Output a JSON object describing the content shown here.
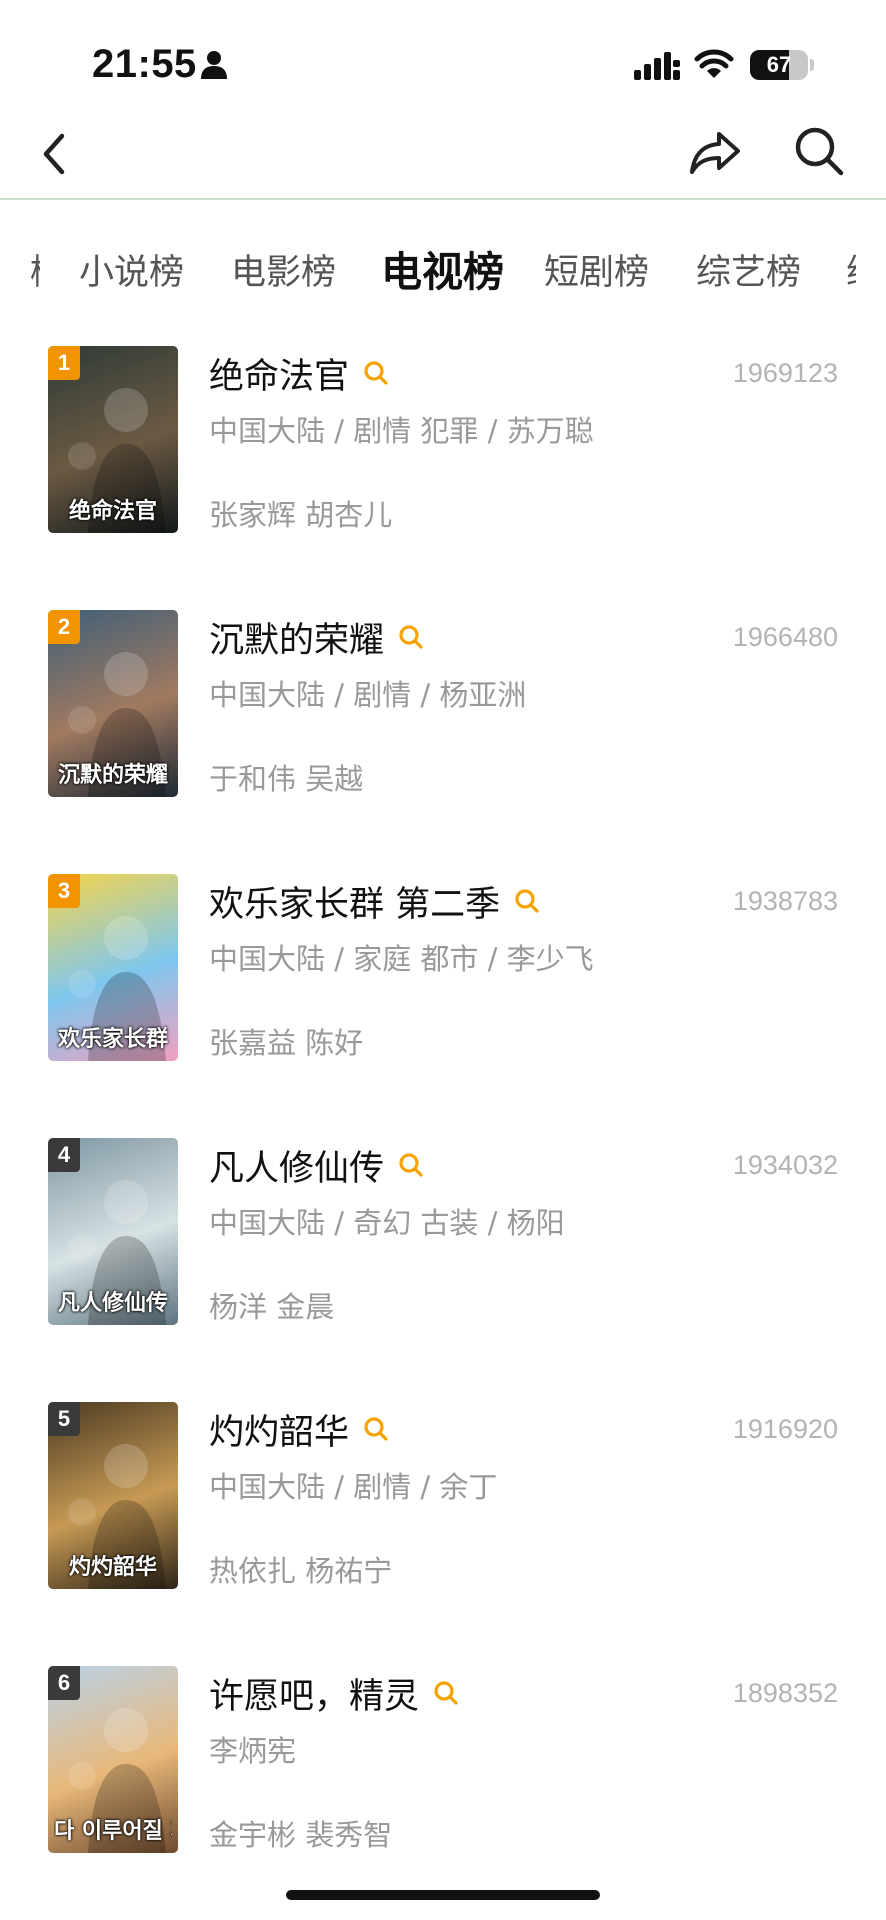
{
  "status_bar": {
    "time": "21:55",
    "battery": "67",
    "battery_level": 0.67,
    "icons": [
      "person-icon",
      "cellular-signal-icon",
      "wifi-icon",
      "battery-icon"
    ]
  },
  "nav": {
    "icons": [
      "back-chevron-icon",
      "share-icon",
      "search-icon"
    ]
  },
  "tabs": {
    "items": [
      "小说榜",
      "电影榜",
      "电视榜",
      "短剧榜",
      "综艺榜"
    ],
    "selected": "电视榜"
  },
  "colors": {
    "rank_top": "#f29300",
    "rank_other": "#3a3a3a",
    "search_accent": "#f5a300",
    "divider": "#c9dcc9"
  },
  "list": [
    {
      "rank": "1",
      "title": "绝命法官",
      "score": "1969123",
      "meta": "中国大陆 / 剧情 犯罪 / 苏万聪",
      "cast": "张家辉 胡杏儿",
      "poster_text": "绝命法官",
      "poster_colors": [
        "#2f3b36",
        "#6b5a43",
        "#12181a"
      ]
    },
    {
      "rank": "2",
      "title": "沉默的荣耀",
      "score": "1966480",
      "meta": "中国大陆 / 剧情 / 杨亚洲",
      "cast": "于和伟 吴越",
      "poster_text": "沉默的荣耀",
      "poster_colors": [
        "#3f5f78",
        "#a07a60",
        "#1e2a36"
      ]
    },
    {
      "rank": "3",
      "title": "欢乐家长群 第二季",
      "score": "1938783",
      "meta": "中国大陆 / 家庭 都市 / 李少飞",
      "cast": "张嘉益 陈好",
      "poster_text": "欢乐家长群",
      "poster_colors": [
        "#f7d44a",
        "#7fc7ee",
        "#f2a0c0"
      ]
    },
    {
      "rank": "4",
      "title": "凡人修仙传",
      "score": "1934032",
      "meta": "中国大陆 / 奇幻 古装 / 杨阳",
      "cast": "杨洋 金晨",
      "poster_text": "凡人修仙传",
      "poster_colors": [
        "#7f97a3",
        "#d7e2e4",
        "#5d7480"
      ]
    },
    {
      "rank": "5",
      "title": "灼灼韶华",
      "score": "1916920",
      "meta": "中国大陆 / 剧情 / 余丁",
      "cast": "热依扎 杨祐宁",
      "poster_text": "灼灼韶华",
      "poster_colors": [
        "#4b3a22",
        "#c79a55",
        "#2e2518"
      ]
    },
    {
      "rank": "6",
      "title": "许愿吧，精灵",
      "score": "1898352",
      "meta": "李炳宪",
      "cast": "金宇彬 裴秀智",
      "poster_text": "다 이루어질 지니",
      "poster_colors": [
        "#b9d2e8",
        "#e8b87a",
        "#6e4a2f"
      ]
    }
  ]
}
